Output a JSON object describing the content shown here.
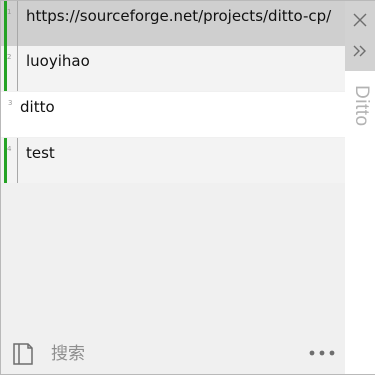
{
  "clips": [
    {
      "index": "1",
      "text": "https://sourceforge.net/projects/ditto-cp/"
    },
    {
      "index": "2",
      "text": "luoyihao"
    },
    {
      "index": "3",
      "text": "ditto"
    },
    {
      "index": "4",
      "text": "test"
    }
  ],
  "sidebar": {
    "title": "Ditto",
    "close_icon": "close-icon",
    "expand_icon": "double-chevron-right-icon"
  },
  "bottom": {
    "search_placeholder": "搜索",
    "note_icon": "note-icon",
    "more_icon": "ellipsis-icon"
  },
  "colors": {
    "accent_bar": "#24a324",
    "selected_row": "#cfcfcf",
    "panel_bg": "#f0f0f0"
  }
}
